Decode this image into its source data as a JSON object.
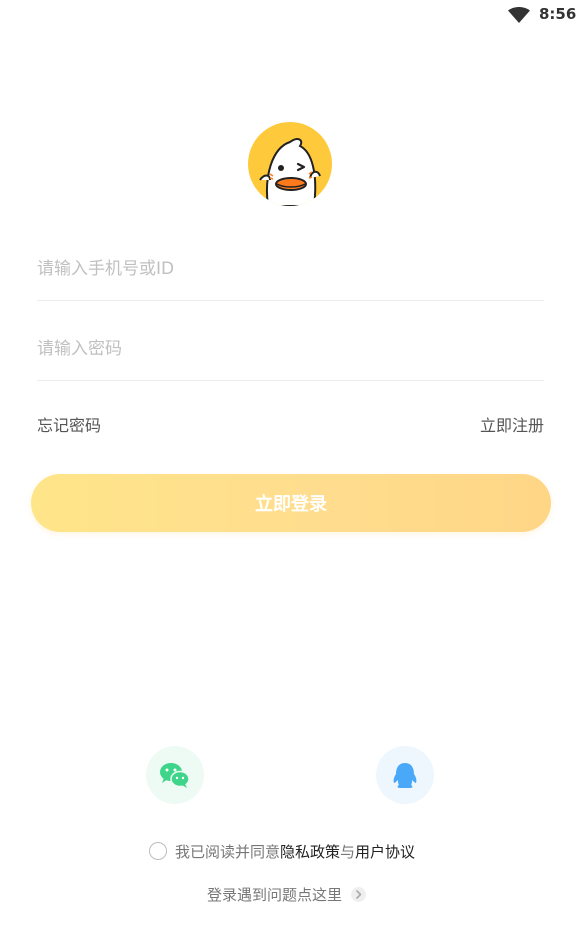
{
  "status_bar": {
    "time": "8:56",
    "wifi_icon": "wifi-icon"
  },
  "logo": {
    "icon": "duck-mascot-icon",
    "bg_color": "#FFC93C"
  },
  "form": {
    "phone_placeholder": "请输入手机号或ID",
    "phone_value": "",
    "password_placeholder": "请输入密码",
    "password_value": ""
  },
  "links": {
    "forgot_password": "忘记密码",
    "register": "立即注册"
  },
  "login_button": {
    "label": "立即登录",
    "color_start": "#FFE58A",
    "color_end": "#FFD686"
  },
  "social": [
    {
      "name": "wechat",
      "icon": "wechat-icon",
      "color": "#3ED48A"
    },
    {
      "name": "qq",
      "icon": "qq-penguin-icon",
      "color": "#4AA8F8"
    }
  ],
  "agreement": {
    "checked": false,
    "prefix": "我已阅读并同意",
    "privacy": "隐私政策",
    "connector": "与",
    "terms": "用户协议"
  },
  "help": {
    "text": "登录遇到问题点这里"
  }
}
